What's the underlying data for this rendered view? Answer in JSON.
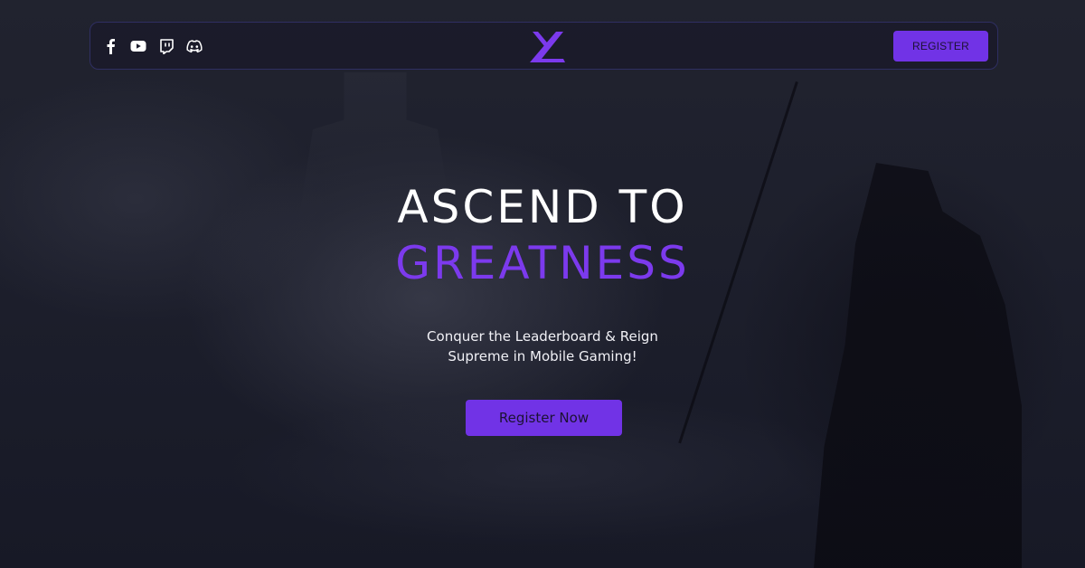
{
  "header": {
    "socials": [
      {
        "name": "facebook-icon"
      },
      {
        "name": "youtube-icon"
      },
      {
        "name": "twitch-icon"
      },
      {
        "name": "discord-icon"
      }
    ],
    "logo": "x-logo-icon",
    "register_label": "REGISTER"
  },
  "hero": {
    "title_line_1": "ASCEND TO",
    "title_line_2": "GREATNESS",
    "subtitle_line_1": "Conquer the Leaderboard & Reign",
    "subtitle_line_2": "Supreme in Mobile Gaming!",
    "cta_label": "Register Now"
  },
  "colors": {
    "accent": "#7c3aed",
    "button": "#7133e6",
    "background": "#191b2a"
  }
}
